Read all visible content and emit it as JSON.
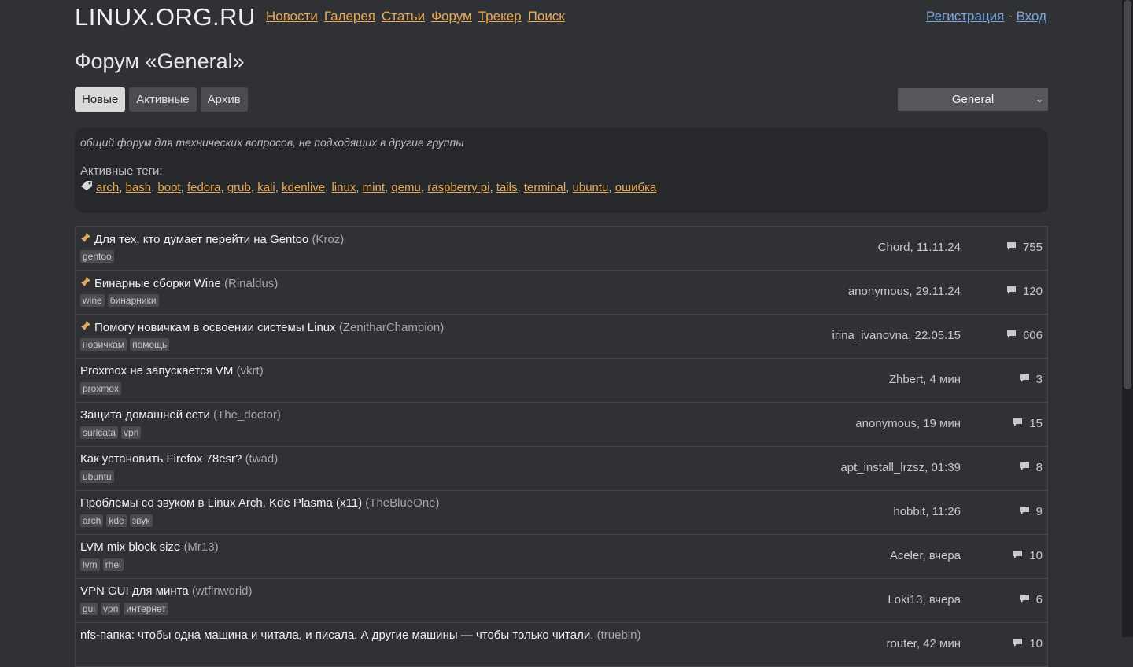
{
  "header": {
    "logo": "LINUX.ORG.RU",
    "nav": [
      "Новости",
      "Галерея",
      "Статьи",
      "Форум",
      "Трекер",
      "Поиск"
    ],
    "register": "Регистрация",
    "sep": "-",
    "login": "Вход"
  },
  "page_title": "Форум «General»",
  "tabs": [
    "Новые",
    "Активные",
    "Архив"
  ],
  "group_select": "General",
  "description": "общий форум для технических вопросов, не подходящих в другие группы",
  "active_tags_title": "Активные теги:",
  "active_tags": [
    "arch",
    "bash",
    "boot",
    "fedora",
    "grub",
    "kali",
    "kdenlive",
    "linux",
    "mint",
    "qemu",
    "raspberry pi",
    "tails",
    "terminal",
    "ubuntu",
    "ошибка"
  ],
  "topics": [
    {
      "pinned": true,
      "title": "Для тех, кто думает перейти на Gentoo",
      "author": "(Kroz)",
      "tags": [
        "gentoo"
      ],
      "last": "Chord, 11.11.24",
      "count": "755"
    },
    {
      "pinned": true,
      "title": "Бинарные сборки Wine",
      "author": "(Rinaldus)",
      "tags": [
        "wine",
        "бинарники"
      ],
      "last": "anonymous, 29.11.24",
      "count": "120"
    },
    {
      "pinned": true,
      "title": "Помогу новичкам в освоении системы Linux",
      "author": "(ZenitharChampion)",
      "tags": [
        "новичкам",
        "помощь"
      ],
      "last": "irina_ivanovna, 22.05.15",
      "count": "606"
    },
    {
      "pinned": false,
      "title": "Proxmox не запускается VM",
      "author": "(vkrt)",
      "tags": [
        "proxmox"
      ],
      "last": "Zhbert, 4 мин",
      "count": "3"
    },
    {
      "pinned": false,
      "title": "Защита домашней сети",
      "author": "(The_doctor)",
      "tags": [
        "suricata",
        "vpn"
      ],
      "last": "anonymous, 19 мин",
      "count": "15"
    },
    {
      "pinned": false,
      "title": "Как установить Firefox 78esr?",
      "author": "(twad)",
      "tags": [
        "ubuntu"
      ],
      "last": "apt_install_lrzsz, 01:39",
      "count": "8"
    },
    {
      "pinned": false,
      "title": "Проблемы со звуком в Linux Arch, Kde Plasma (x11)",
      "author": "(TheBlueOne)",
      "tags": [
        "arch",
        "kde",
        "звук"
      ],
      "last": "hobbit, 11:26",
      "count": "9"
    },
    {
      "pinned": false,
      "title": "LVM mix block size",
      "author": "(Mr13)",
      "tags": [
        "lvm",
        "rhel"
      ],
      "last": "Aceler, вчера",
      "count": "10"
    },
    {
      "pinned": false,
      "title": "VPN GUI для минта",
      "author": "(wtfinworld)",
      "tags": [
        "gui",
        "vpn",
        "интернет"
      ],
      "last": "Loki13, вчера",
      "count": "6"
    },
    {
      "pinned": false,
      "title": "nfs-папка: чтобы одна машина и читала, и писала. А другие машины — чтобы только читали.",
      "author": "(truebin)",
      "tags": [],
      "last": "router, 42 мин",
      "count": "10"
    }
  ]
}
